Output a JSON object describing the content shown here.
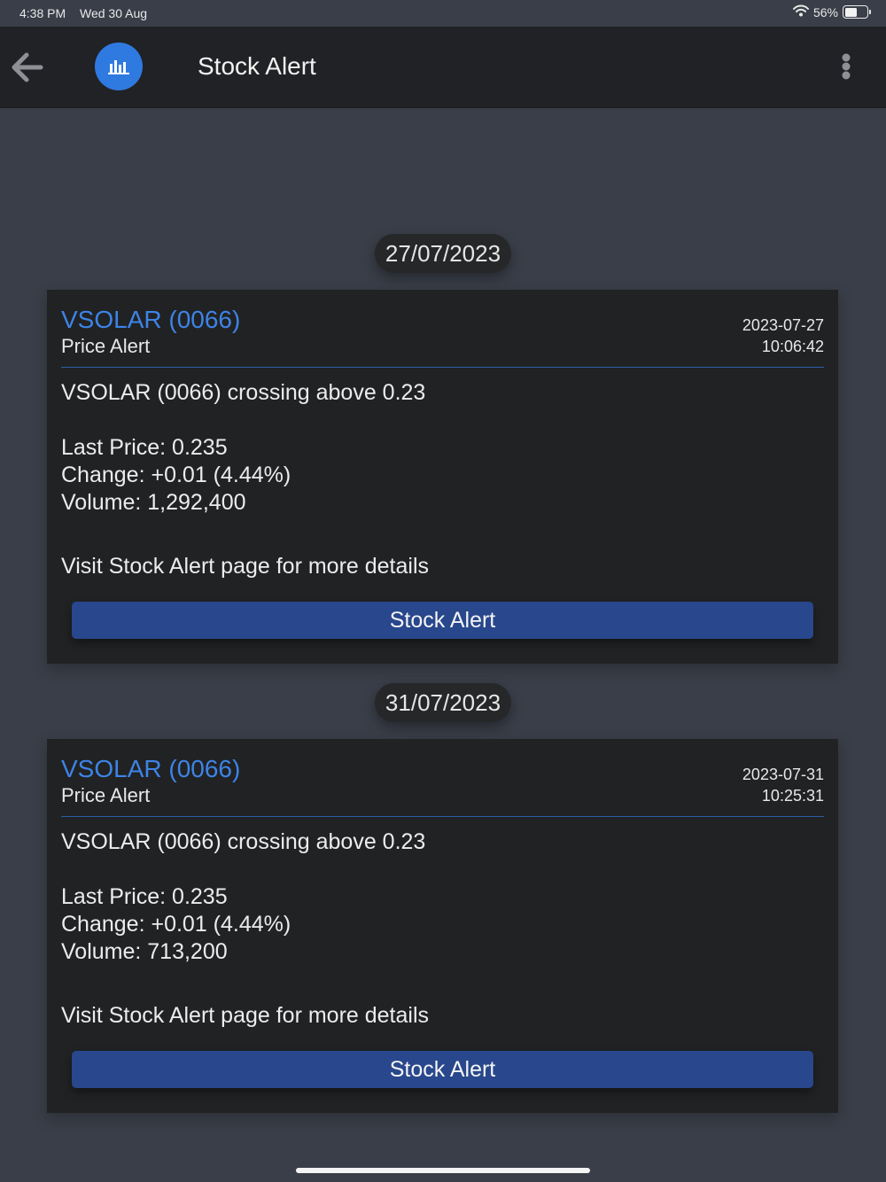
{
  "status_bar": {
    "time": "4:38 PM",
    "date": "Wed 30 Aug",
    "battery": "56%",
    "battery_level": 0.56
  },
  "navbar": {
    "title": "Stock Alert"
  },
  "alerts": [
    {
      "date_chip": "27/07/2023",
      "symbol": "VSOLAR (0066)",
      "type": "Price Alert",
      "date": "2023-07-27",
      "time": "10:06:42",
      "message": "VSOLAR (0066) crossing above 0.23",
      "last_price": "Last Price: 0.235",
      "change": "Change: +0.01 (4.44%)",
      "volume": "Volume: 1,292,400",
      "visit": "Visit Stock Alert page for more details",
      "button": "Stock Alert"
    },
    {
      "date_chip": "31/07/2023",
      "symbol": "VSOLAR (0066)",
      "type": "Price Alert",
      "date": "2023-07-31",
      "time": "10:25:31",
      "message": "VSOLAR (0066) crossing above 0.23",
      "last_price": "Last Price: 0.235",
      "change": "Change: +0.01 (4.44%)",
      "volume": "Volume: 713,200",
      "visit": "Visit Stock Alert page for more details",
      "button": "Stock Alert"
    }
  ]
}
